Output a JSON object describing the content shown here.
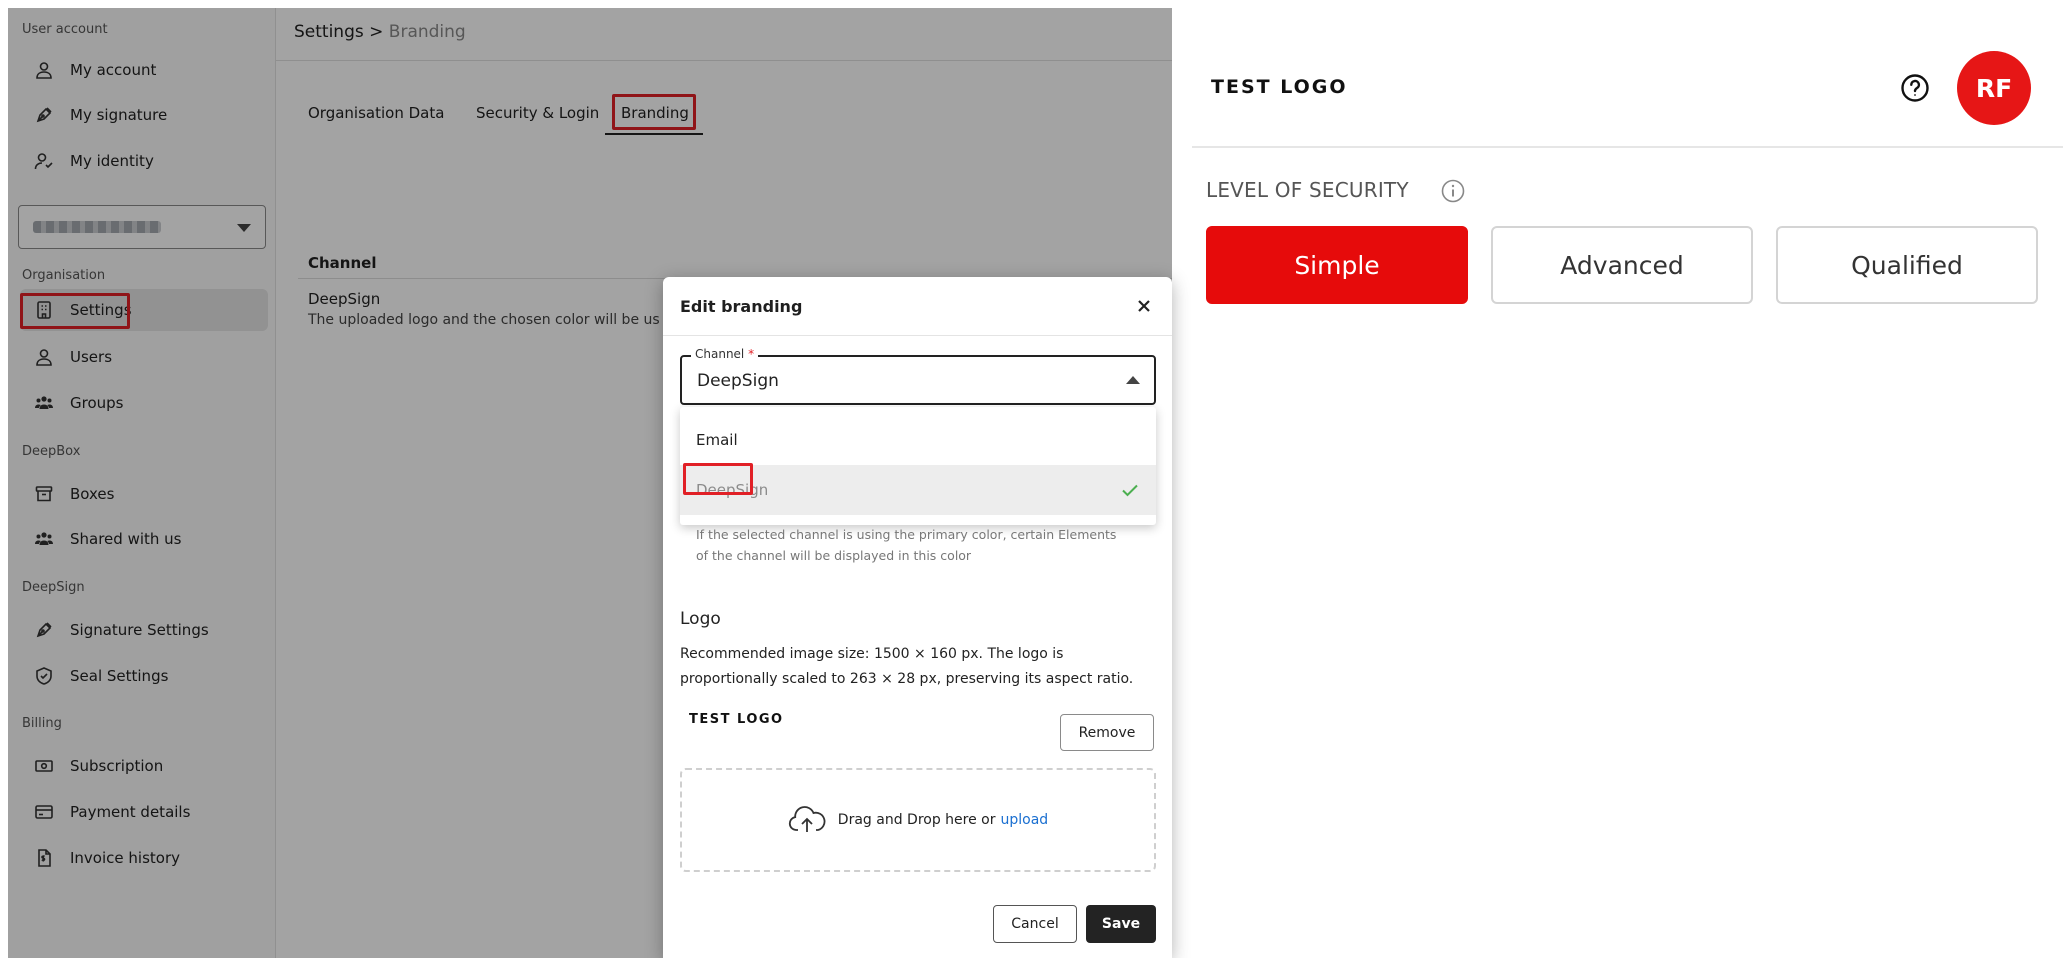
{
  "sidebar": {
    "sections": {
      "user_account": "User account",
      "organisation": "Organisation",
      "deepbox": "DeepBox",
      "deepsign": "DeepSign",
      "billing": "Billing"
    },
    "items": {
      "my_account": "My account",
      "my_signature": "My signature",
      "my_identity": "My identity",
      "settings": "Settings",
      "users": "Users",
      "groups": "Groups",
      "boxes": "Boxes",
      "shared_with_us": "Shared with us",
      "signature_settings": "Signature Settings",
      "seal_settings": "Seal Settings",
      "subscription": "Subscription",
      "payment_details": "Payment details",
      "invoice_history": "Invoice history"
    },
    "active_item": "Settings"
  },
  "breadcrumb": {
    "parent": "Settings",
    "separator": ">",
    "current": "Branding"
  },
  "tabs": [
    {
      "label": "Organisation Data"
    },
    {
      "label": "Security & Login"
    },
    {
      "label": "Branding"
    }
  ],
  "table": {
    "column": "Channel",
    "row_title": "DeepSign",
    "row_desc": "The uploaded logo and the chosen color will be us"
  },
  "dialog": {
    "title": "Edit branding",
    "channel_label": "Channel",
    "required_mark": "*",
    "channel_value": "DeepSign",
    "options": [
      {
        "label": "Email",
        "selected": false
      },
      {
        "label": "DeepSign",
        "selected": true
      }
    ],
    "color_help_line1": "If the selected channel is using the primary color, certain Elements",
    "color_help_line2": "of the channel will be displayed in this color",
    "logo_label": "Logo",
    "logo_help_line1": "Recommended image size: 1500 × 160 px. The logo is",
    "logo_help_line2": "proportionally scaled to 263 × 28 px, preserving its aspect ratio.",
    "logo_preview_text": "TEST LOGO",
    "remove_label": "Remove",
    "dropzone_text": "Drag and Drop here or",
    "upload_link": "upload",
    "cancel_label": "Cancel",
    "save_label": "Save"
  },
  "preview": {
    "logo_text": "TEST LOGO",
    "avatar_initials": "RF",
    "security_label": "LEVEL OF SECURITY",
    "levels": [
      {
        "label": "Simple",
        "selected": true
      },
      {
        "label": "Advanced",
        "selected": false
      },
      {
        "label": "Qualified",
        "selected": false
      }
    ]
  },
  "colors": {
    "accent_red": "#e60b0b",
    "highlight_red": "#e12026",
    "primary_dark": "#232323",
    "link_blue": "#1a6fd1"
  },
  "icons": [
    "user-icon",
    "pen-icon",
    "identity-icon",
    "building-icon",
    "users-icon",
    "groups-icon",
    "archive-icon",
    "shield-check-icon",
    "money-icon",
    "credit-card-icon",
    "invoice-icon",
    "close-icon",
    "check-icon",
    "cloud-upload-icon",
    "help-icon",
    "info-icon"
  ]
}
